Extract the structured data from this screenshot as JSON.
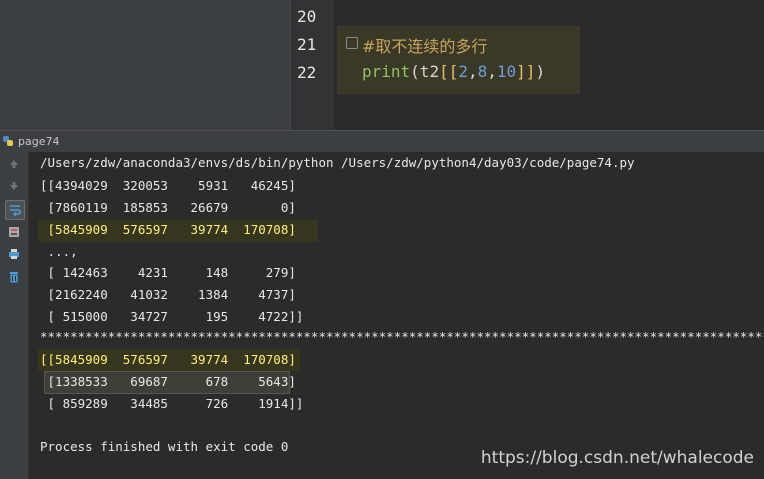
{
  "editor": {
    "lines": [
      {
        "num": "20"
      },
      {
        "num": "21",
        "comment": "#取不连续的多行"
      },
      {
        "num": "22",
        "code": {
          "fn": "print",
          "open": "(t2",
          "b1": "[[",
          "n1": "2",
          "c1": ",",
          "n2": "8",
          "c2": ",",
          "n3": "10",
          "b2": "]]",
          "close": ")"
        }
      }
    ]
  },
  "run": {
    "tab_label": "page74",
    "toolbar_icons": [
      "arrow-up-icon",
      "arrow-down-icon",
      "soft-wrap-icon",
      "scroll-to-end-icon",
      "print-icon",
      "trash-icon"
    ],
    "console": {
      "command": "/Users/zdw/anaconda3/envs/ds/bin/python /Users/zdw/python4/day03/code/page74.py",
      "block1": [
        "[[4394029  320053    5931   46245]",
        " [7860119  185853   26679       0]",
        " [5845909  576597   39774  170708]",
        " ...,",
        " [ 142463    4231     148     279]",
        " [2162240   41032    1384    4737]",
        " [ 515000   34727     195    4722]]"
      ],
      "separator": "******************************************************************************************************************",
      "block2": [
        "[[5845909  576597   39774  170708]",
        " [1338533   69687     678    5643]",
        " [ 859289   34485     726    1914]]"
      ],
      "finish": "Process finished with exit code 0"
    }
  },
  "watermark": "https://blog.csdn.net/whalecode"
}
